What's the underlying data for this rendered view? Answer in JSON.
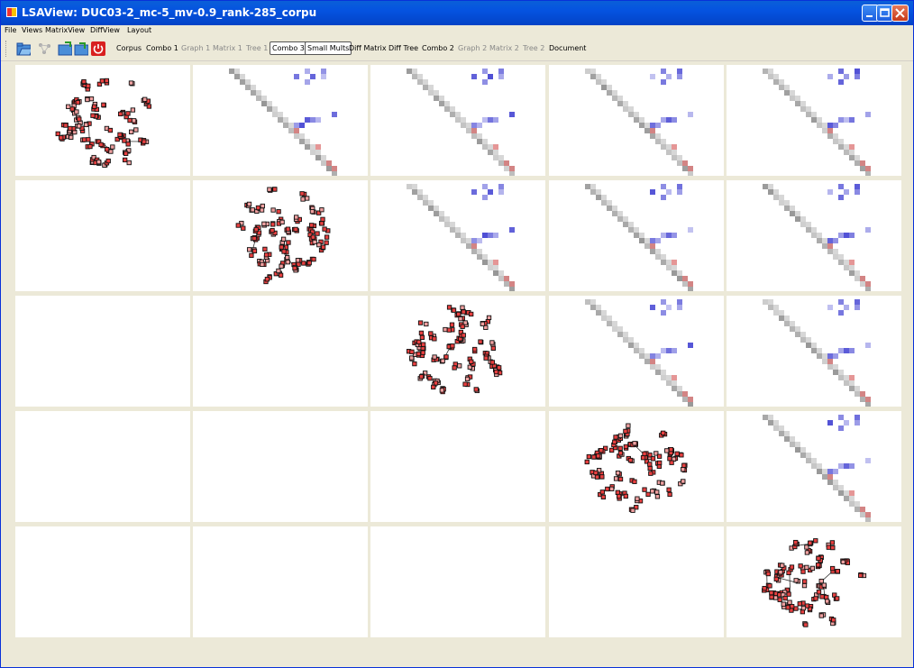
{
  "window": {
    "title": "LSAView: DUC03-2_mc-5_mv-0.9_rank-285_corpu"
  },
  "menu": [
    "File",
    "Views",
    "MatrixView",
    "DiffView",
    "Layout"
  ],
  "toolbar": {
    "icons": [
      "open-folder-icon",
      "graph-network-icon",
      "folder-export-icon",
      "folder-import-icon",
      "power-icon"
    ],
    "tabs": [
      {
        "label": "Corpus",
        "state": "enabled"
      },
      {
        "label": "Combo 1",
        "state": "enabled"
      },
      {
        "label": "Graph 1",
        "state": "disabled"
      },
      {
        "label": "Matrix 1",
        "state": "disabled"
      },
      {
        "label": "Tree 1",
        "state": "disabled"
      },
      {
        "label": "Combo 3",
        "state": "pressed"
      },
      {
        "label": "Small Mults",
        "state": "pressed"
      },
      {
        "label": "Diff Matrix",
        "state": "enabled"
      },
      {
        "label": "Diff Tree",
        "state": "enabled"
      },
      {
        "label": "Combo 2",
        "state": "enabled"
      },
      {
        "label": "Graph 2",
        "state": "disabled"
      },
      {
        "label": "Matrix 2",
        "state": "disabled"
      },
      {
        "label": "Tree 2",
        "state": "disabled"
      },
      {
        "label": "Document",
        "state": "enabled"
      }
    ]
  },
  "small_multiples": {
    "rows": 5,
    "cols": 5,
    "cells": [
      [
        "graph",
        "matrix",
        "matrix",
        "matrix",
        "matrix"
      ],
      [
        "empty",
        "graph",
        "matrix",
        "matrix",
        "matrix"
      ],
      [
        "empty",
        "empty",
        "graph",
        "matrix",
        "matrix"
      ],
      [
        "empty",
        "empty",
        "empty",
        "graph",
        "matrix"
      ],
      [
        "empty",
        "empty",
        "empty",
        "empty",
        "graph"
      ]
    ]
  },
  "colors": {
    "titlebar": "#0553e0",
    "node_fill": "#e84040",
    "node_stroke": "#111111",
    "matrix_gray": "#a8a8a8",
    "matrix_blue": "#3a3ad0",
    "matrix_red": "#d04040"
  }
}
